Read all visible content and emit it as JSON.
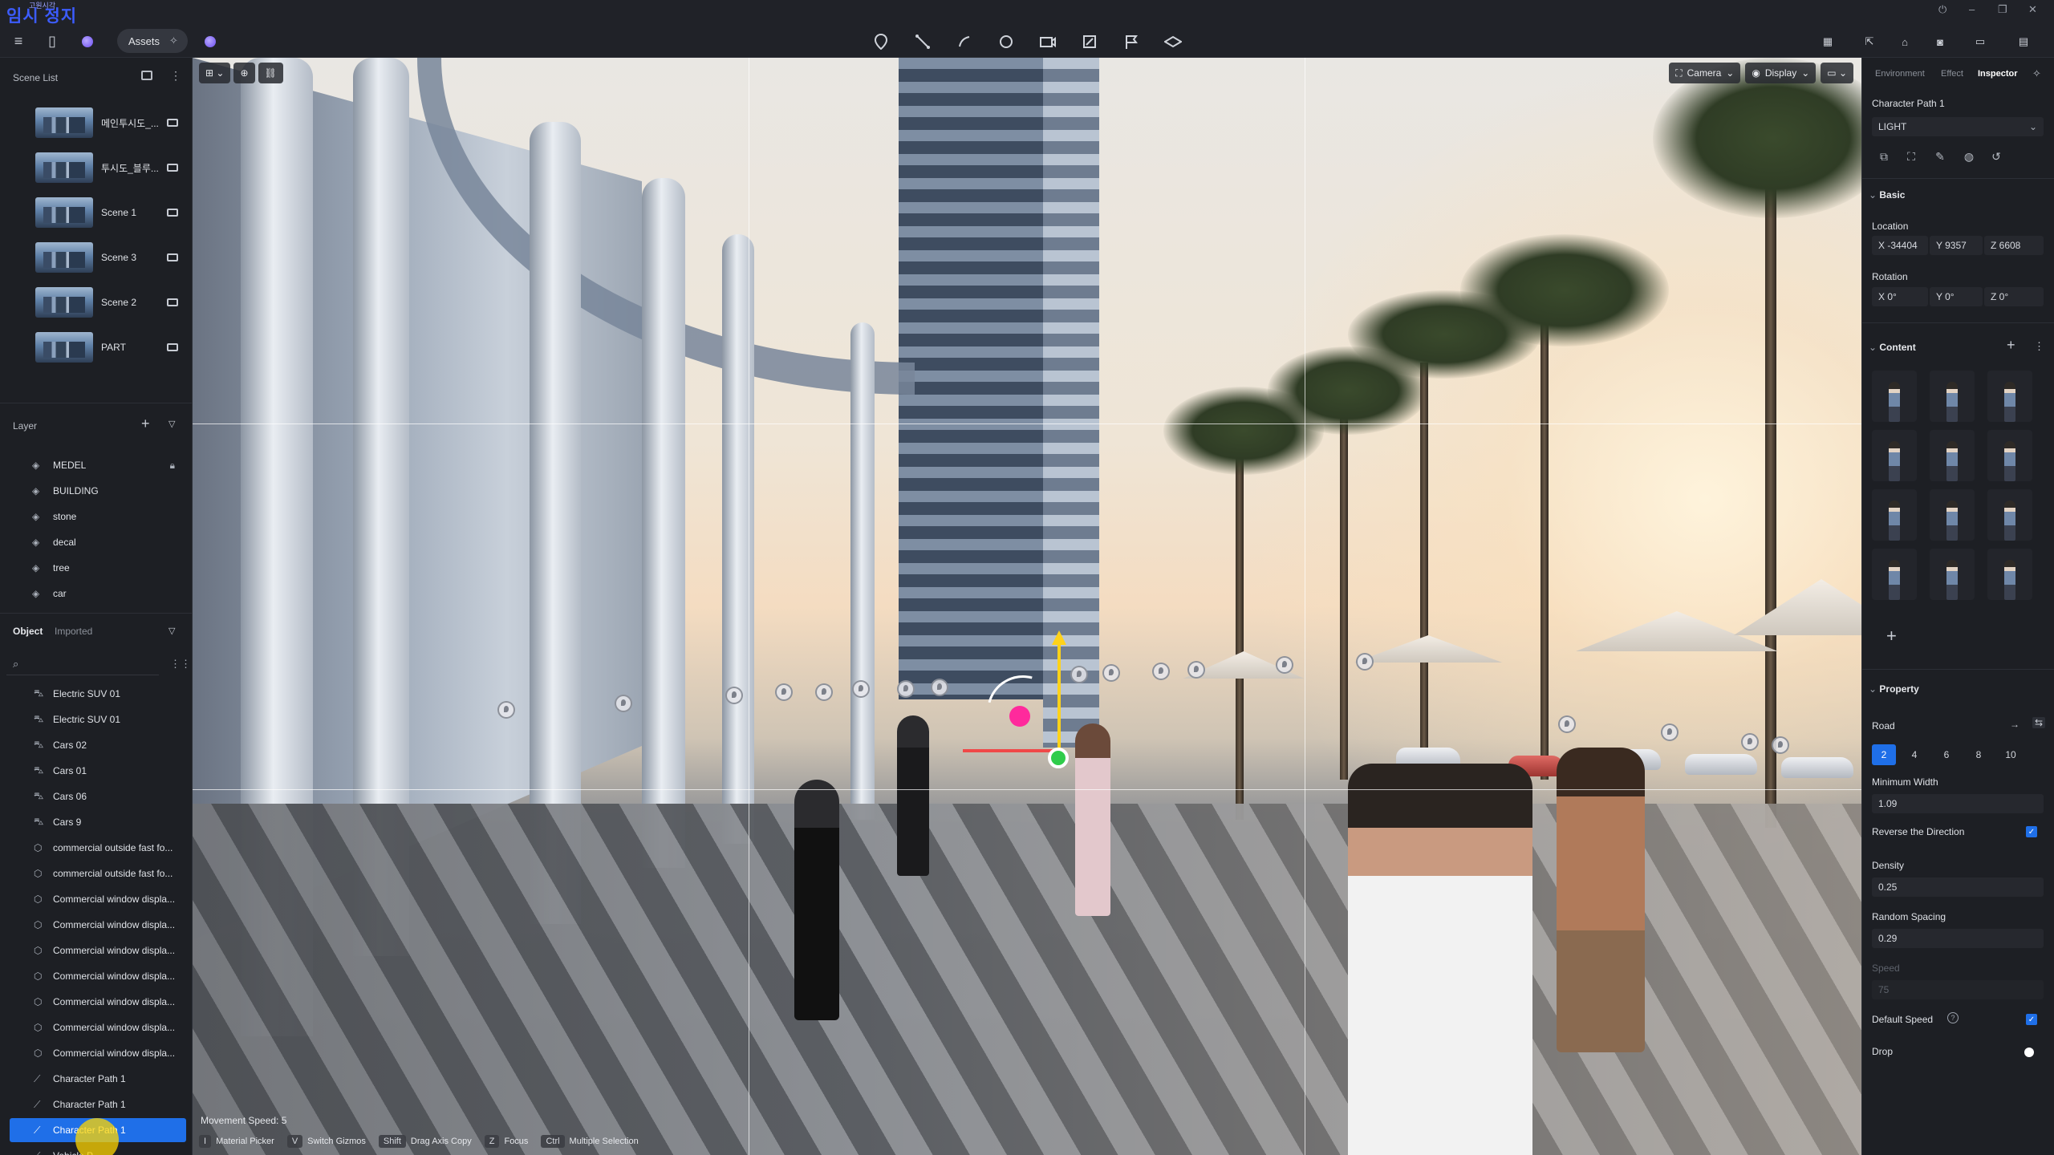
{
  "watermark": {
    "title": "임시 정지",
    "small": "고원시각"
  },
  "topbar": {
    "assets_label": "Assets",
    "window_controls": [
      "⏻",
      "–",
      "❐",
      "✕"
    ]
  },
  "left": {
    "scene_list": {
      "title": "Scene List",
      "items": [
        {
          "label": "메인투시도_..."
        },
        {
          "label": "투시도_블루..."
        },
        {
          "label": "Scene 1"
        },
        {
          "label": "Scene 3"
        },
        {
          "label": "Scene 2"
        },
        {
          "label": "PART"
        }
      ]
    },
    "layer": {
      "title": "Layer",
      "items": [
        "MEDEL",
        "BUILDING",
        "stone",
        "decal",
        "tree",
        "car"
      ]
    },
    "object": {
      "tab_object": "Object",
      "tab_imported": "Imported",
      "items": [
        {
          "label": "Electric SUV 01",
          "kind": "car"
        },
        {
          "label": "Electric SUV 01",
          "kind": "car"
        },
        {
          "label": "Cars 02",
          "kind": "car"
        },
        {
          "label": "Cars 01",
          "kind": "car"
        },
        {
          "label": "Cars 06",
          "kind": "car"
        },
        {
          "label": "Cars 9",
          "kind": "car"
        },
        {
          "label": "commercial outside fast fo...",
          "kind": "object"
        },
        {
          "label": "commercial outside fast fo...",
          "kind": "object"
        },
        {
          "label": "Commercial window displa...",
          "kind": "object"
        },
        {
          "label": "Commercial window displa...",
          "kind": "object"
        },
        {
          "label": "Commercial window displa...",
          "kind": "object"
        },
        {
          "label": "Commercial window displa...",
          "kind": "object"
        },
        {
          "label": "Commercial window displa...",
          "kind": "object"
        },
        {
          "label": "Commercial window displa...",
          "kind": "object"
        },
        {
          "label": "Commercial window displa...",
          "kind": "object"
        },
        {
          "label": "Character Path 1",
          "kind": "path"
        },
        {
          "label": "Character Path 1",
          "kind": "path"
        },
        {
          "label": "Character Path 1",
          "kind": "path",
          "selected": true
        },
        {
          "label": "Vehicle P...",
          "kind": "path"
        }
      ]
    }
  },
  "viewport": {
    "camera_label": "Camera",
    "display_label": "Display",
    "movement_speed": "Movement Speed: 5",
    "shortcuts": [
      {
        "key": "I",
        "desc": "Material Picker"
      },
      {
        "key": "V",
        "desc": "Switch Gizmos"
      },
      {
        "key": "Shift",
        "desc": "Drag Axis Copy"
      },
      {
        "key": "Z",
        "desc": "Focus"
      },
      {
        "key": "Ctrl",
        "desc": "Multiple Selection"
      }
    ]
  },
  "inspector": {
    "tabs": [
      "Environment",
      "Effect",
      "Inspector"
    ],
    "object_name": "Character Path 1",
    "preset": "LIGHT",
    "basic": {
      "title": "Basic",
      "location_label": "Location",
      "location": {
        "x": "X -34404",
        "y": "Y 9357",
        "z": "Z 6608"
      },
      "rotation_label": "Rotation",
      "rotation": {
        "x": "X 0°",
        "y": "Y 0°",
        "z": "Z 0°"
      }
    },
    "content": {
      "title": "Content",
      "count": 12
    },
    "property": {
      "title": "Property",
      "road_label": "Road",
      "road_options": [
        "2",
        "4",
        "6",
        "8",
        "10"
      ],
      "road_selected": "2",
      "min_width_label": "Minimum Width",
      "min_width": "1.09",
      "reverse_label": "Reverse the Direction",
      "reverse_checked": true,
      "density_label": "Density",
      "density": "0.25",
      "random_spacing_label": "Random Spacing",
      "random_spacing": "0.29",
      "speed_label": "Speed",
      "speed": "75",
      "default_speed_label": "Default Speed",
      "default_speed_checked": true,
      "drop_label": "Drop"
    }
  }
}
